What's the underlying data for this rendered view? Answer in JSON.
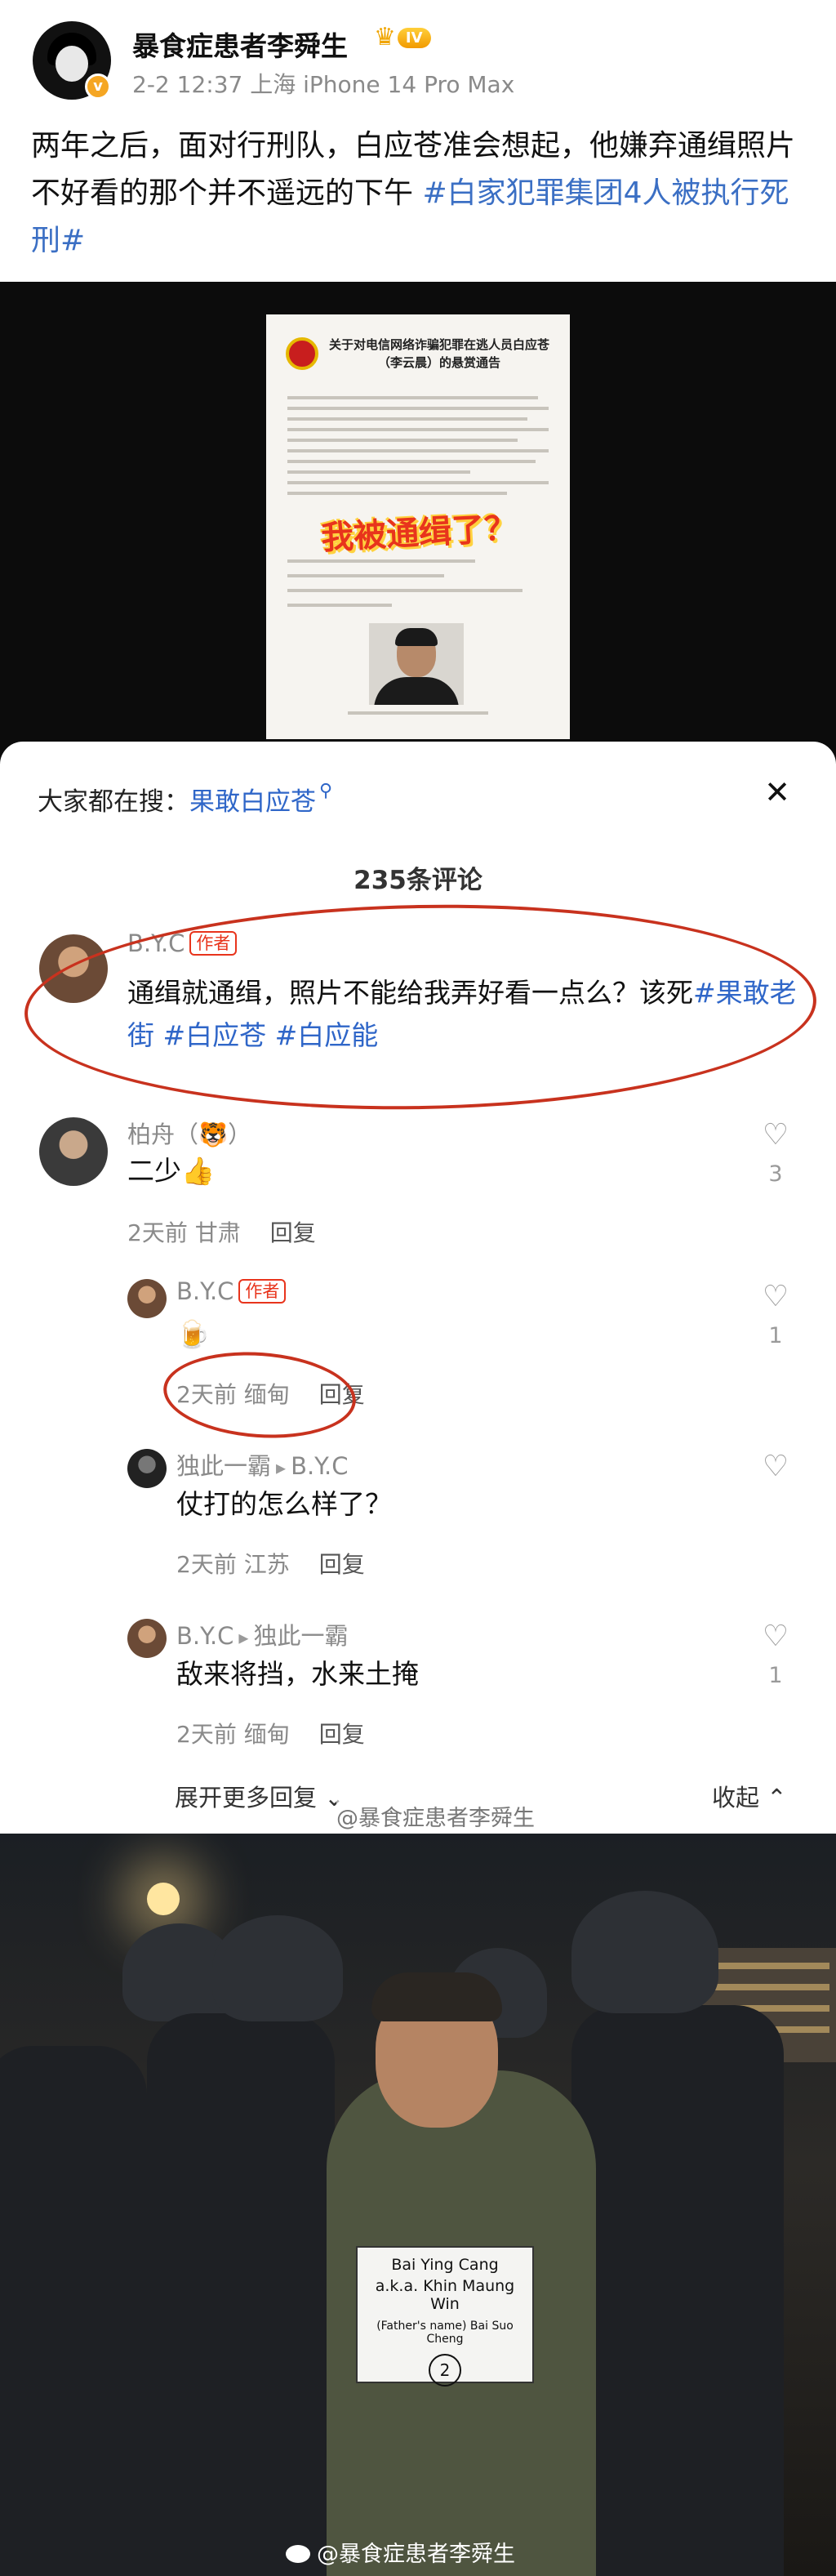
{
  "post": {
    "username": "暴食症患者李舜生",
    "vip_level": "IV",
    "meta": "2-2 12:37 上海 iPhone 14 Pro Max",
    "text": "两年之后，面对行刑队，白应苍准会想起，他嫌弃通缉照片不好看的那个并不遥远的下午 ",
    "hashtag": "#白家犯罪集团4人被执行死刑#"
  },
  "notice": {
    "title": "关于对电信网络诈骗犯罪在逃人员白应苍（李云晨）的悬赏通告",
    "stamp_text": "我被通缉了？"
  },
  "panel": {
    "search_prefix": "大家都在搜：",
    "search_keyword": "果敢白应苍",
    "comment_count": "235条评论",
    "expand_label": "展开更多回复",
    "collapse_label": "收起",
    "watermark": "@暴食症患者李舜生"
  },
  "comments": [
    {
      "name": "B.Y.C",
      "author_tag": "作者",
      "text": "通缉就通缉，照片不能给我弄好看一点么？该死",
      "tags": [
        "#果敢老街",
        "#白应苍",
        "#白应能"
      ]
    },
    {
      "name": "柏舟（🐯）",
      "text": "二少👍",
      "time": "2天前 甘肃",
      "reply": "回复",
      "likes": "3"
    },
    {
      "name": "B.Y.C",
      "author_tag": "作者",
      "text": "🍺",
      "time": "2天前 缅甸",
      "reply": "回复",
      "likes": "1"
    },
    {
      "name": "独此一霸",
      "reply_to": "B.Y.C",
      "text": "仗打的怎么样了？",
      "time": "2天前 江苏",
      "reply": "回复"
    },
    {
      "name": "B.Y.C",
      "reply_to": "独此一霸",
      "text": "敌来将挡，水来土掩",
      "time": "2天前 缅甸",
      "reply": "回复",
      "likes": "1"
    }
  ],
  "photo": {
    "card_line1": "Bai Ying Cang",
    "card_line2": "a.k.a. Khin Maung Win",
    "card_line3": "(Father's name) Bai Suo Cheng",
    "card_number": "2",
    "watermark": "@暴食症患者李舜生"
  }
}
